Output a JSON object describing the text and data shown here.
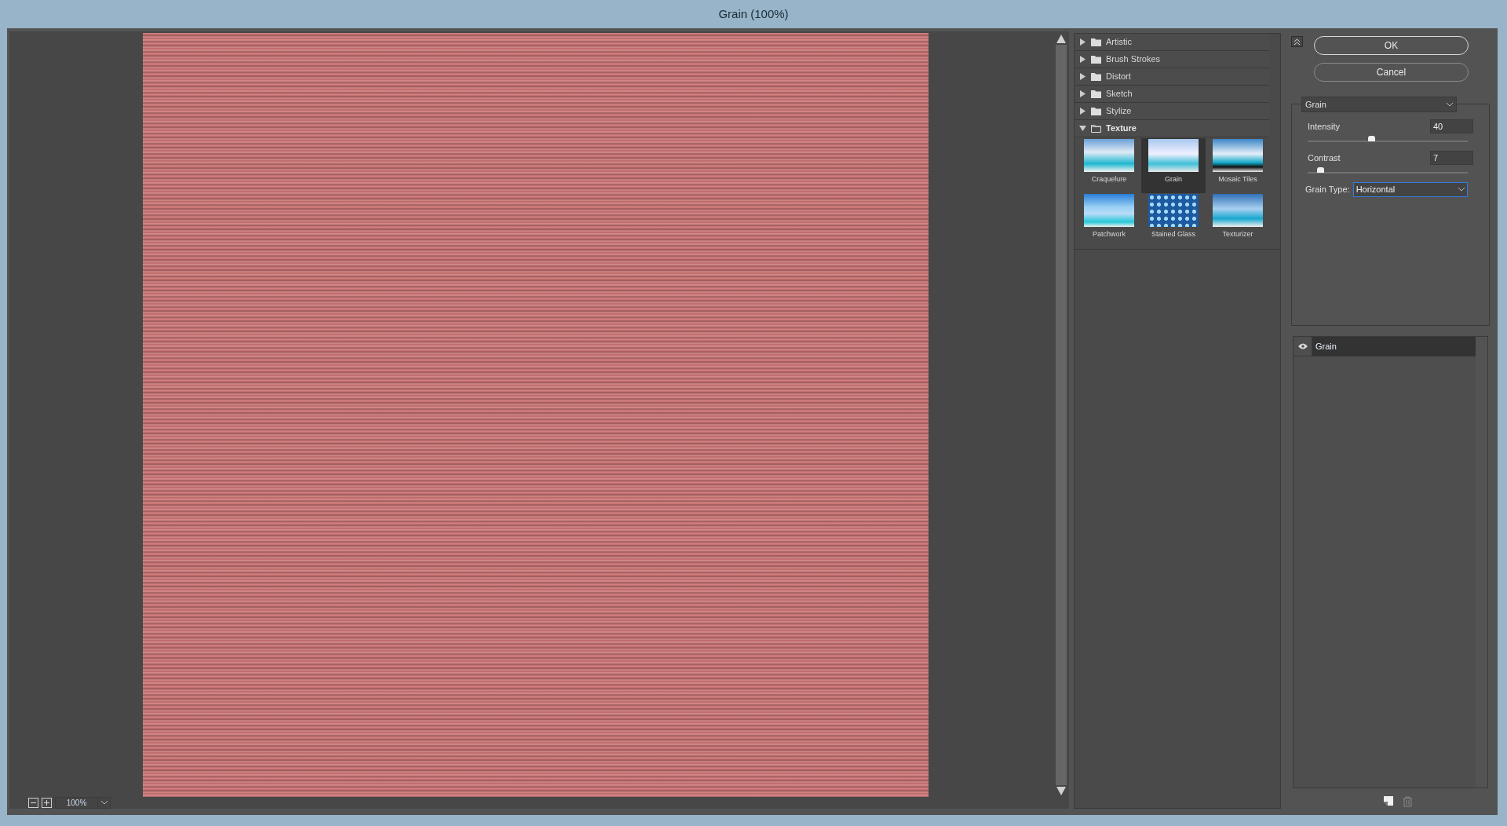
{
  "window": {
    "title": "Grain (100%)"
  },
  "preview": {
    "zoom": "100%"
  },
  "filter_groups": [
    {
      "label": "Artistic",
      "expanded": false
    },
    {
      "label": "Brush Strokes",
      "expanded": false
    },
    {
      "label": "Distort",
      "expanded": false
    },
    {
      "label": "Sketch",
      "expanded": false
    },
    {
      "label": "Stylize",
      "expanded": false
    },
    {
      "label": "Texture",
      "expanded": true,
      "children": [
        {
          "label": "Craquelure",
          "selected": false
        },
        {
          "label": "Grain",
          "selected": true
        },
        {
          "label": "Mosaic Tiles",
          "selected": false
        },
        {
          "label": "Patchwork",
          "selected": false
        },
        {
          "label": "Stained Glass",
          "selected": false
        },
        {
          "label": "Texturizer",
          "selected": false
        }
      ]
    }
  ],
  "buttons": [
    "OK",
    "Cancel"
  ],
  "settings": {
    "filter": "Grain",
    "sliders": [
      {
        "label": "Intensity",
        "value": "40",
        "level": 0.4
      },
      {
        "label": "Contrast",
        "value": "7",
        "level": 0.08
      }
    ],
    "grain_type": {
      "label": "Grain Type:",
      "value": "Horizontal"
    }
  },
  "layers": [
    {
      "label": "Grain",
      "visible": true,
      "selected": true
    }
  ]
}
